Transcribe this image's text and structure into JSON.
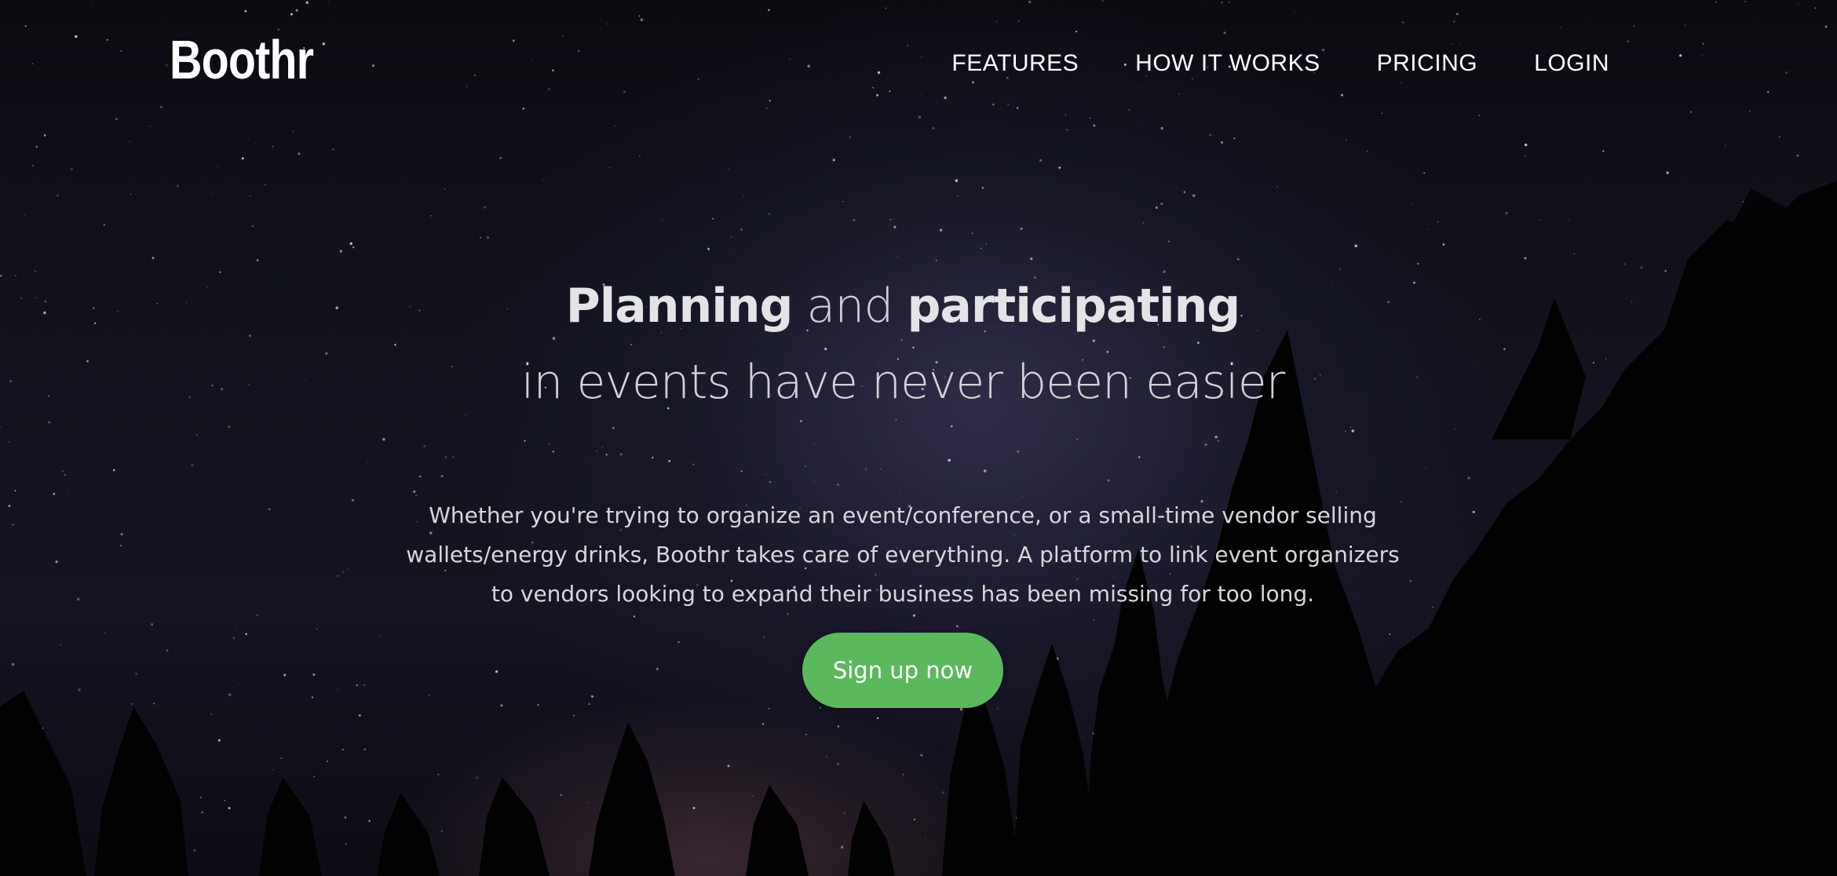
{
  "brand": {
    "logo_text": "Boothr"
  },
  "nav": {
    "items": [
      {
        "label": "FEATURES"
      },
      {
        "label": "HOW IT WORKS"
      },
      {
        "label": "PRICING"
      },
      {
        "label": "LOGIN"
      }
    ]
  },
  "hero": {
    "headline_part1": "Planning",
    "headline_part2": " and ",
    "headline_part3": "participating",
    "headline_line2": "in events have never been easier",
    "description": "Whether you're trying to organize an event/conference, or a small-time vendor selling wallets/energy drinks, Boothr takes care of everything. A platform to link event organizers to vendors looking to expand their business has been missing for too long.",
    "cta_label": "Sign up now"
  },
  "colors": {
    "cta_background": "#5cb85c",
    "nav_text": "#ffffff",
    "background": "#0b0c12"
  }
}
